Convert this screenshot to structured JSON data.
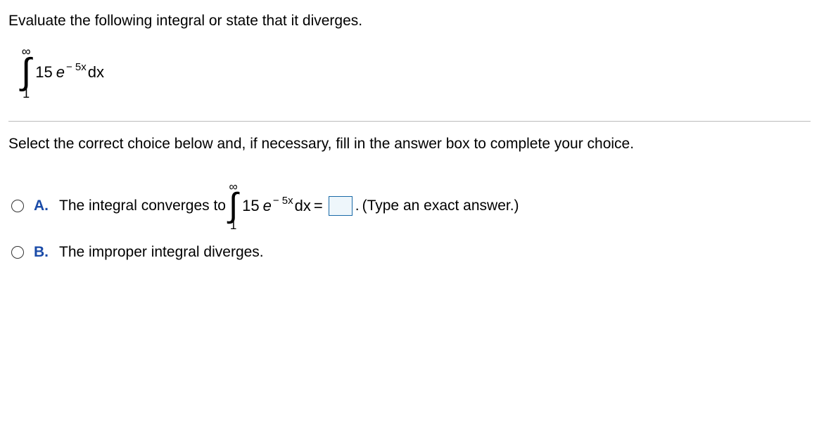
{
  "question": {
    "prompt": "Evaluate the following integral or state that it diverges.",
    "integral": {
      "upper": "∞",
      "lower": "1",
      "coefficient": "15",
      "e": "e",
      "exponent": "− 5x",
      "dx": "dx"
    }
  },
  "instruction": "Select the correct choice below and, if necessary, fill in the answer box to complete your choice.",
  "choices": {
    "a": {
      "label": "A.",
      "pre_text": "The integral converges to",
      "integral": {
        "upper": "∞",
        "lower": "1",
        "coefficient": "15",
        "e": "e",
        "exponent": "− 5x",
        "dx": "dx",
        "equals": "="
      },
      "period": ".",
      "hint": "(Type an exact answer.)"
    },
    "b": {
      "label": "B.",
      "text": "The improper integral diverges."
    }
  }
}
